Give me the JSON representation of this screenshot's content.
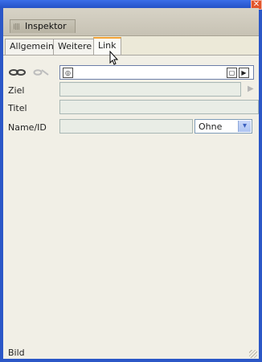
{
  "window": {
    "close_glyph": "✕"
  },
  "panel": {
    "title": "Inspektor"
  },
  "tabs": [
    {
      "label": "Allgemein"
    },
    {
      "label": "Weitere"
    },
    {
      "label": "Link"
    }
  ],
  "fields": {
    "ziel": {
      "label": "Ziel"
    },
    "titel": {
      "label": "Titel"
    },
    "name_id": {
      "label": "Name/ID",
      "select_value": "Ohne"
    }
  },
  "status": {
    "text": "Bild"
  },
  "colors": {
    "accent": "#f2a33a",
    "window_frame": "#2b57c7"
  }
}
